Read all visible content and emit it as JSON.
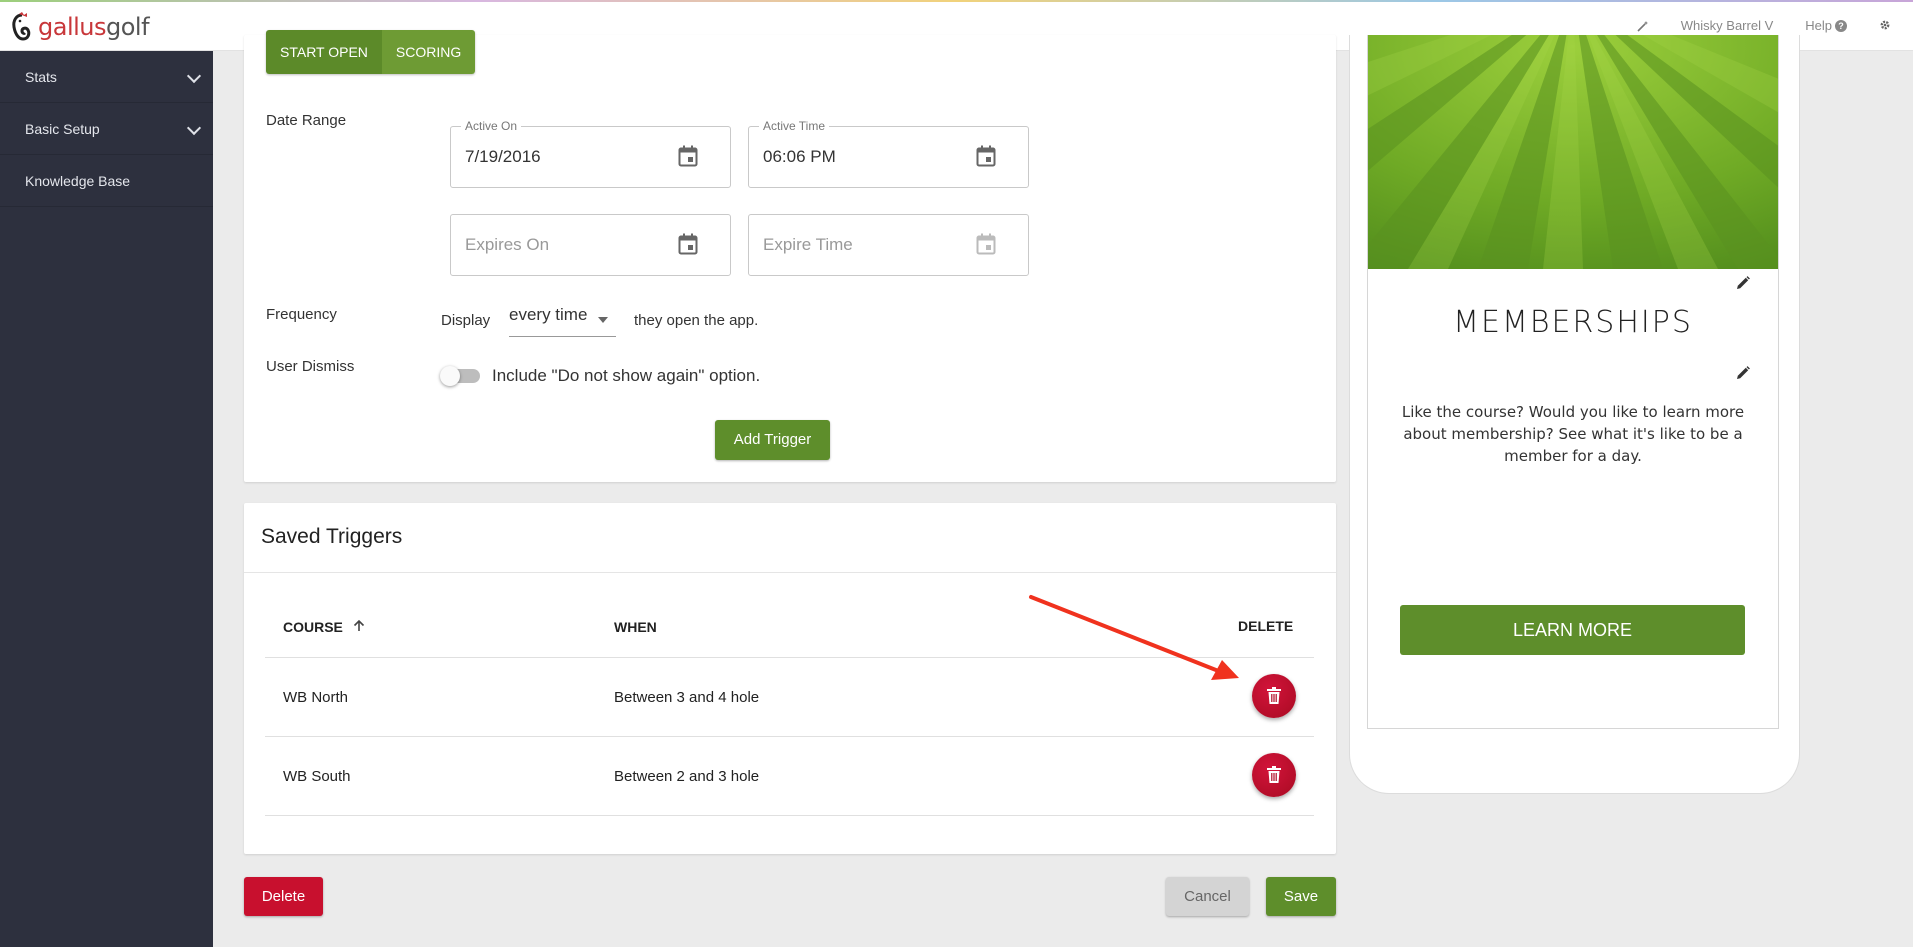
{
  "brand": {
    "name_part1": "gallus",
    "name_part2": "golf"
  },
  "topbar": {
    "course": "Whisky Barrel V",
    "help": "Help"
  },
  "sidebar": {
    "items": [
      {
        "label": "Stats"
      },
      {
        "label": "Basic Setup"
      },
      {
        "label": "Knowledge Base"
      }
    ]
  },
  "form": {
    "trigger_types": [
      "Start Open",
      "Scoring"
    ],
    "date_range_label": "Date Range",
    "active_on": {
      "label": "Active On",
      "value": "7/19/2016"
    },
    "active_time": {
      "label": "Active Time",
      "value": "06:06 PM"
    },
    "expires_on": {
      "placeholder": "Expires On"
    },
    "expire_time": {
      "placeholder": "Expire Time"
    },
    "frequency_label": "Frequency",
    "display_prefix": "Display",
    "frequency_value": "every time",
    "display_suffix": "they open the app.",
    "user_dismiss_label": "User Dismiss",
    "dismiss_option": "Include \"Do not show again\" option.",
    "dismiss_enabled": false,
    "add_trigger": "Add Trigger"
  },
  "saved_triggers": {
    "title": "Saved Triggers",
    "columns": {
      "course": "COURSE",
      "when": "WHEN",
      "delete": "DELETE"
    },
    "rows": [
      {
        "course": "WB North",
        "when": "Between 3 and 4 hole"
      },
      {
        "course": "WB South",
        "when": "Between 2 and 3 hole"
      }
    ]
  },
  "actions": {
    "delete": "Delete",
    "cancel": "Cancel",
    "save": "Save"
  },
  "preview": {
    "title": "MEMBERSHIPS",
    "body": "Like the course? Would you like to learn more about membership? See what it's like to be a member for a day.",
    "button": "LEARN MORE"
  },
  "colors": {
    "sidebar_bg": "#2d303e",
    "accent_green": "#5e8e2b",
    "danger_red": "#c8102e",
    "annotation_arrow": "#f0321e"
  }
}
